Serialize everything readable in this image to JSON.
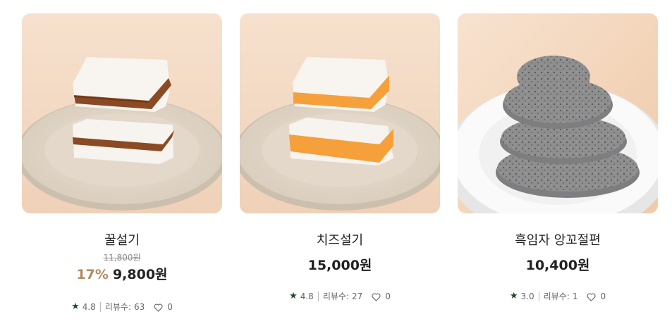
{
  "products": [
    {
      "name": "꿀설기",
      "original_price": "11,800원",
      "discount": "17%",
      "price": "9,800원",
      "rating": "4.8",
      "review_label": "리뷰수:",
      "review_count": "63",
      "likes": "0",
      "image_icon": "honey-rice-cake-image"
    },
    {
      "name": "치즈설기",
      "price": "15,000원",
      "rating": "4.8",
      "review_label": "리뷰수:",
      "review_count": "27",
      "likes": "0",
      "image_icon": "cheese-rice-cake-image"
    },
    {
      "name": "흑임자 앙꼬절편",
      "price": "10,400원",
      "rating": "3.0",
      "review_label": "리뷰수:",
      "review_count": "1",
      "likes": "0",
      "image_icon": "black-sesame-rice-cake-image"
    }
  ],
  "colors": {
    "discount": "#b08a5e",
    "star": "#1d4d2a",
    "text": "#222222",
    "muted": "#666666"
  },
  "icons": {
    "rating": "star-icon",
    "like": "heart-icon"
  }
}
